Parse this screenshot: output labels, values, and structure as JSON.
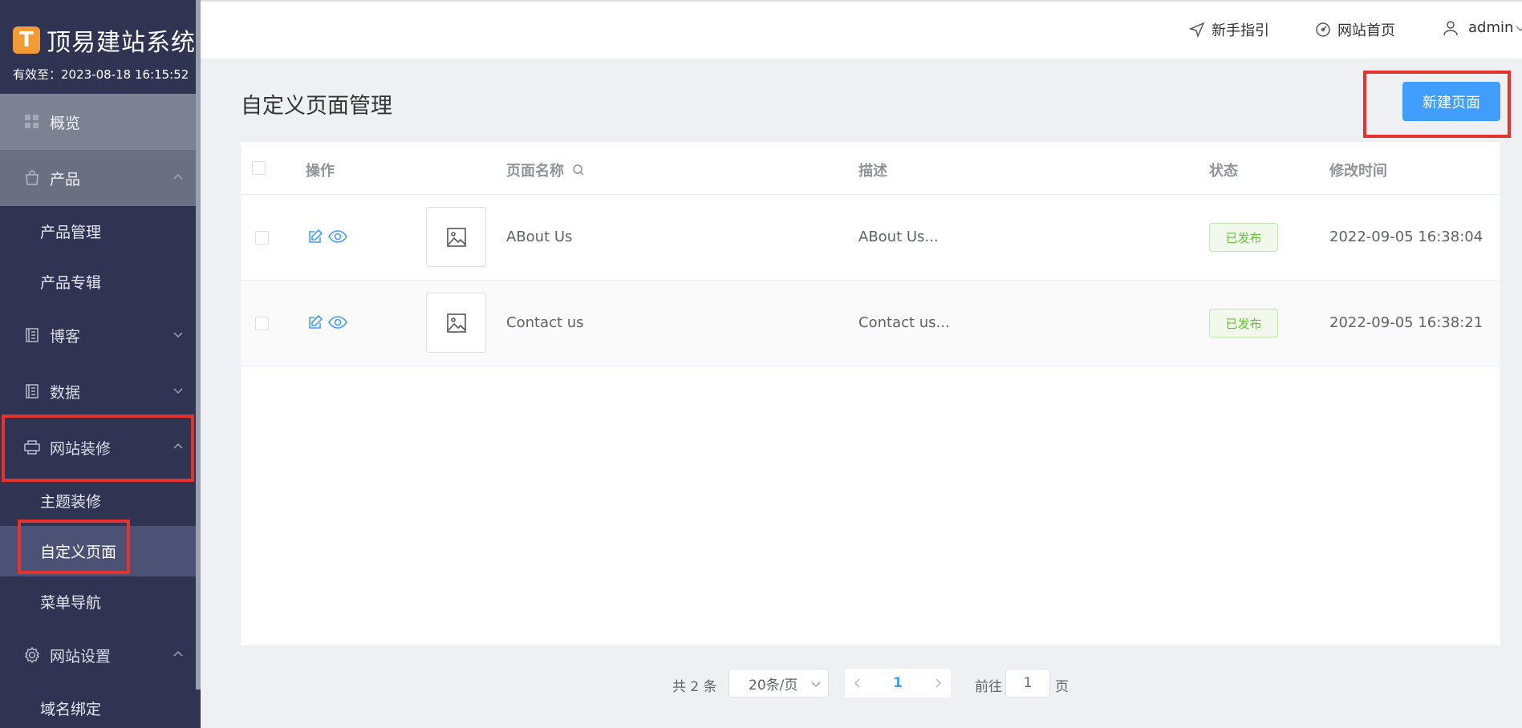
{
  "brand": {
    "logo_glyph": "T",
    "title": "顶易建站系统",
    "expiry": "有效至：2023-08-18 16:15:52"
  },
  "sidebar": {
    "overview": "概览",
    "products": "产品",
    "product_sub": [
      "产品管理",
      "产品专辑"
    ],
    "blog": "博客",
    "data": "数据",
    "decor": "网站装修",
    "decor_sub": [
      "主题装修",
      "自定义页面",
      "菜单导航"
    ],
    "settings": "网站设置",
    "settings_sub": [
      "域名绑定"
    ]
  },
  "topbar": {
    "guide": "新手指引",
    "home": "网站首页",
    "user": "admin"
  },
  "page": {
    "title": "自定义页面管理",
    "new_button": "新建页面"
  },
  "table": {
    "columns": {
      "ops": "操作",
      "name": "页面名称",
      "desc": "描述",
      "status": "状态",
      "modified": "修改时间"
    },
    "rows": [
      {
        "name": "ABout Us",
        "desc": "ABout Us...",
        "status": "已发布",
        "modified": "2022-09-05 16:38:04"
      },
      {
        "name": "Contact us",
        "desc": "Contact us...",
        "status": "已发布",
        "modified": "2022-09-05 16:38:21"
      }
    ]
  },
  "pagination": {
    "total": "共 2 条",
    "page_size": "20条/页",
    "current": "1",
    "goto_label": "前往",
    "goto_value": "1",
    "page_suffix": "页"
  },
  "colors": {
    "sidebar_bg": "#2f3452",
    "primary": "#409eff",
    "highlight": "#e5322d",
    "success": "#67c23a"
  }
}
